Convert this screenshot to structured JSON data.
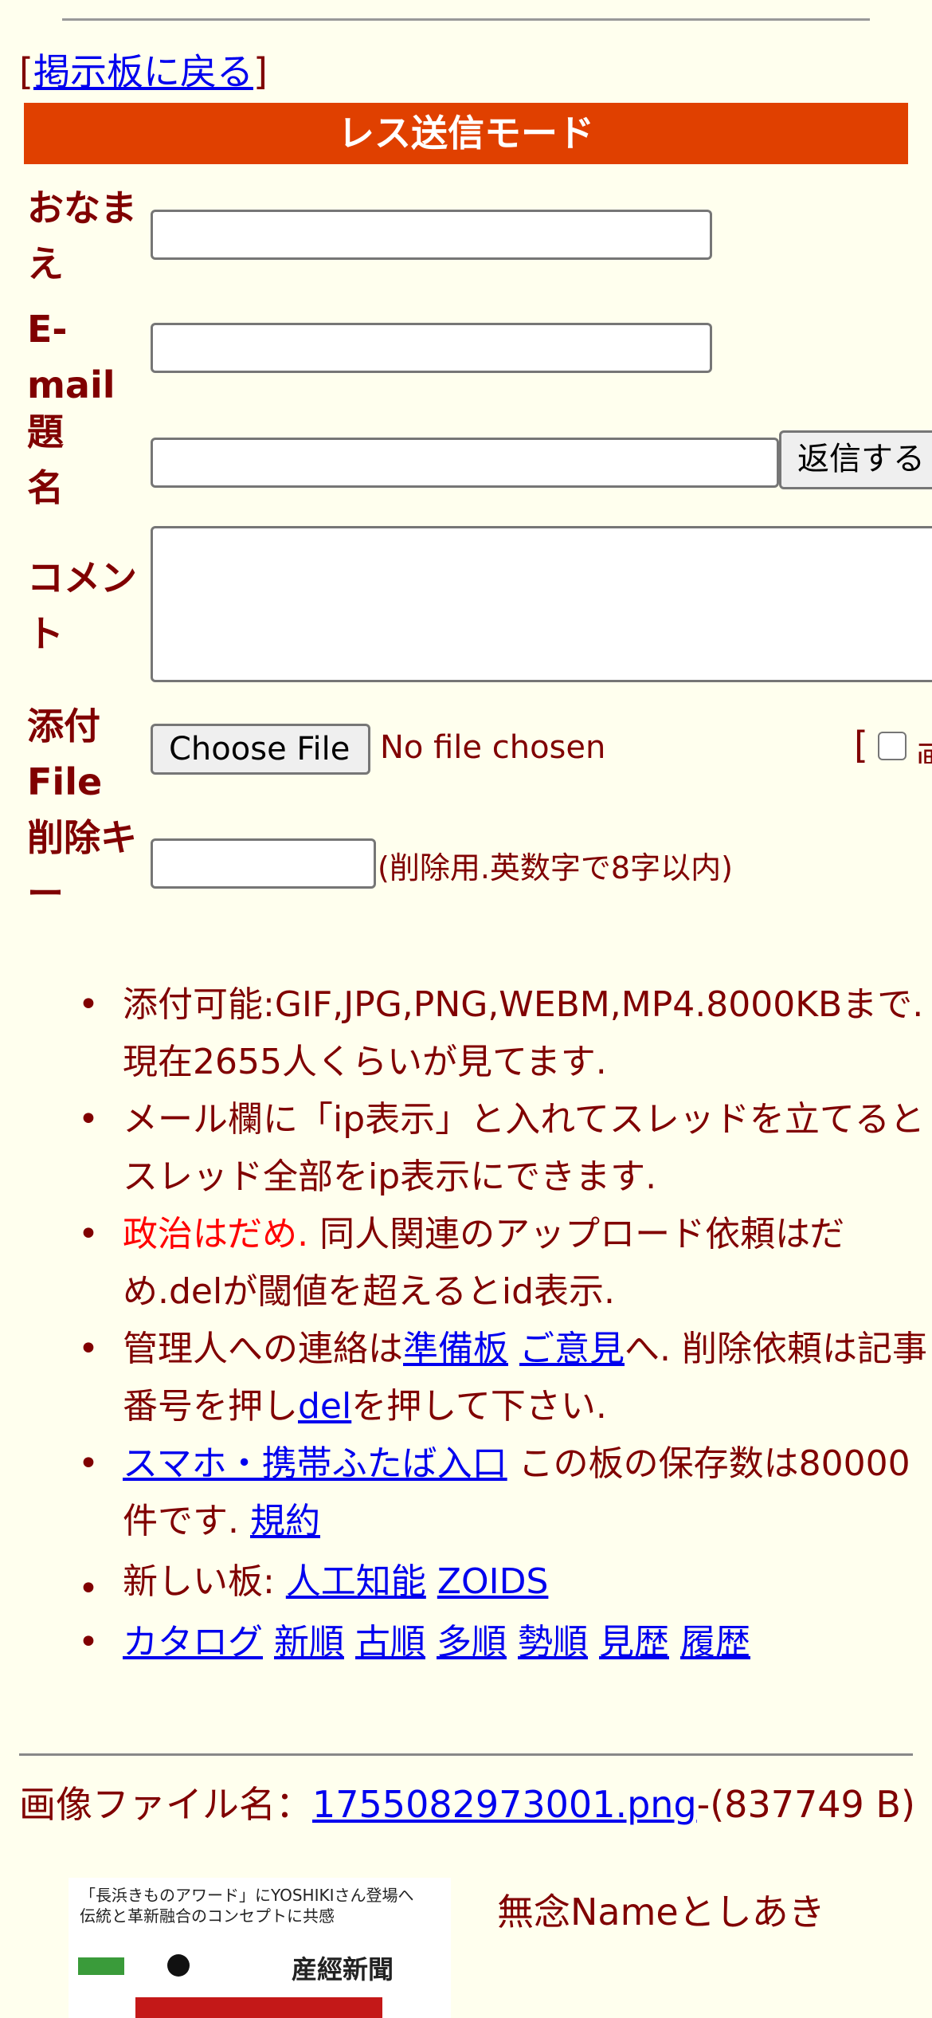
{
  "nav": {
    "back_open": "[",
    "back_link": "掲示板に戻る",
    "back_close": "]"
  },
  "form": {
    "banner": "レス送信モード",
    "name_label": "おなまえ",
    "email_label": "E-mail",
    "subject_label": "題名",
    "submit_label": "返信する",
    "comment_label": "コメント",
    "file_label": "添付File",
    "choose_file_label": "Choose File",
    "no_file_text": "No file chosen",
    "extra_bracket": "[",
    "delete_key_label": "削除キー",
    "delete_key_note": "(削除用.英数字で8字以内)"
  },
  "rules": {
    "r1": "添付可能:GIF,JPG,PNG,WEBM,MP4.8000KBまで. 現在2655人くらいが見てます.",
    "r2": "メール欄に「ip表示」と入れてスレッドを立てるとスレッド全部をip表示にできます.",
    "r3_red": "政治はだめ.",
    "r3_rest": " 同人関連のアップロード依頼はだめ.delが閾値を超えるとid表示.",
    "r4_a": "管理人への連絡は",
    "r4_link1": "準備板",
    "r4_link2": "ご意見",
    "r4_b": "へ. 削除依頼は記事番号を押し",
    "r4_link3": "del",
    "r4_c": "を押して下さい.",
    "r5_link1": "スマホ・携帯ふたば入口",
    "r5_b": " この板の保存数は80000件です. ",
    "r5_link2": "規約",
    "r6_label": "新しい板: ",
    "r6_link1": "人工知能",
    "r6_link2": "ZOIDS",
    "r7_links": [
      "カタログ",
      "新順",
      "古順",
      "多順",
      "勢順",
      "見歴",
      "履歴"
    ]
  },
  "post": {
    "file_prefix": "画像ファイル名：",
    "file_link": "1755082973001.png",
    "file_size": "-(837749 B)",
    "thumb_line1": "「長浜きものアワード」にYOSHIKIさん登場へ",
    "thumb_line2": "伝統と革新融合のコンセプトに共感",
    "thumb_logo": "産經新聞",
    "poster_name": "無念Nameとしあき"
  }
}
